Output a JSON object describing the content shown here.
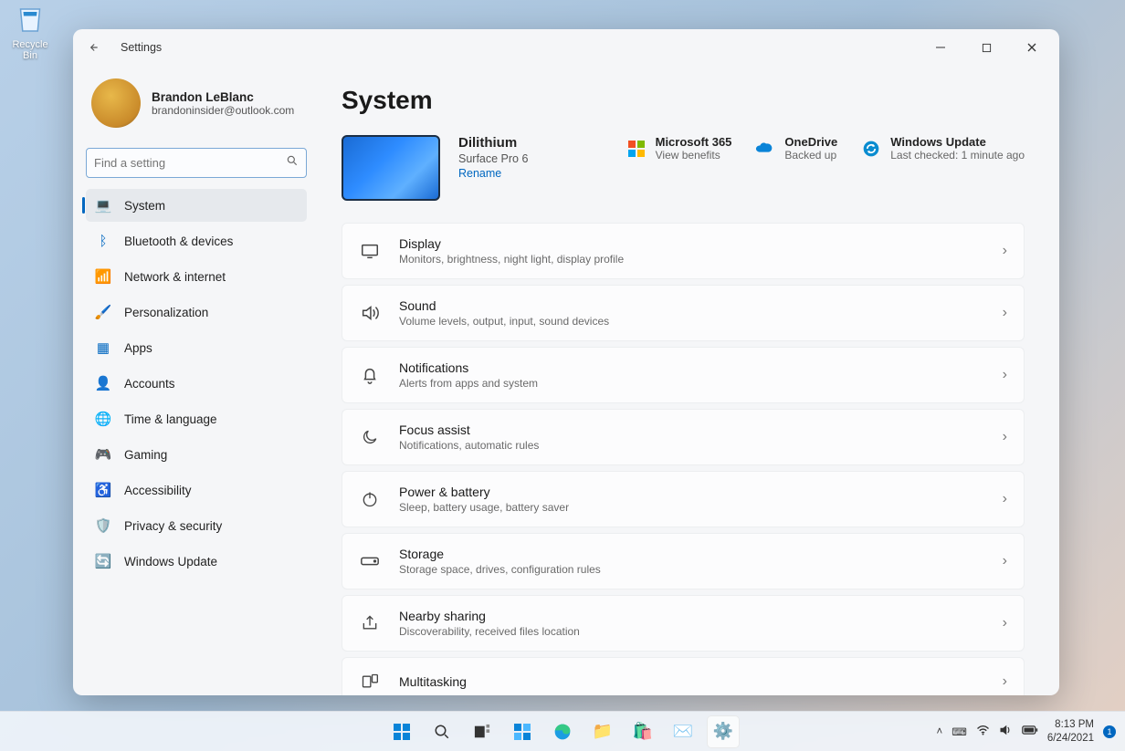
{
  "desktop": {
    "recycle_bin": "Recycle Bin"
  },
  "window": {
    "title": "Settings",
    "profile": {
      "name": "Brandon LeBlanc",
      "email": "brandoninsider@outlook.com"
    },
    "search_placeholder": "Find a setting",
    "nav": [
      {
        "label": "System",
        "icon": "💻"
      },
      {
        "label": "Bluetooth & devices",
        "icon": "ᛒ"
      },
      {
        "label": "Network & internet",
        "icon": "📶"
      },
      {
        "label": "Personalization",
        "icon": "🖌️"
      },
      {
        "label": "Apps",
        "icon": "▦"
      },
      {
        "label": "Accounts",
        "icon": "👤"
      },
      {
        "label": "Time & language",
        "icon": "🌐"
      },
      {
        "label": "Gaming",
        "icon": "🎮"
      },
      {
        "label": "Accessibility",
        "icon": "♿"
      },
      {
        "label": "Privacy & security",
        "icon": "🛡️"
      },
      {
        "label": "Windows Update",
        "icon": "🔄"
      }
    ],
    "page_title": "System",
    "device": {
      "name": "Dilithium",
      "model": "Surface Pro 6",
      "rename": "Rename"
    },
    "status": {
      "m365": {
        "title": "Microsoft 365",
        "sub": "View benefits"
      },
      "onedrive": {
        "title": "OneDrive",
        "sub": "Backed up"
      },
      "update": {
        "title": "Windows Update",
        "sub": "Last checked: 1 minute ago"
      }
    },
    "tiles": [
      {
        "title": "Display",
        "sub": "Monitors, brightness, night light, display profile"
      },
      {
        "title": "Sound",
        "sub": "Volume levels, output, input, sound devices"
      },
      {
        "title": "Notifications",
        "sub": "Alerts from apps and system"
      },
      {
        "title": "Focus assist",
        "sub": "Notifications, automatic rules"
      },
      {
        "title": "Power & battery",
        "sub": "Sleep, battery usage, battery saver"
      },
      {
        "title": "Storage",
        "sub": "Storage space, drives, configuration rules"
      },
      {
        "title": "Nearby sharing",
        "sub": "Discoverability, received files location"
      },
      {
        "title": "Multitasking",
        "sub": ""
      }
    ]
  },
  "taskbar": {
    "time": "8:13 PM",
    "date": "6/24/2021",
    "badge": "1"
  }
}
